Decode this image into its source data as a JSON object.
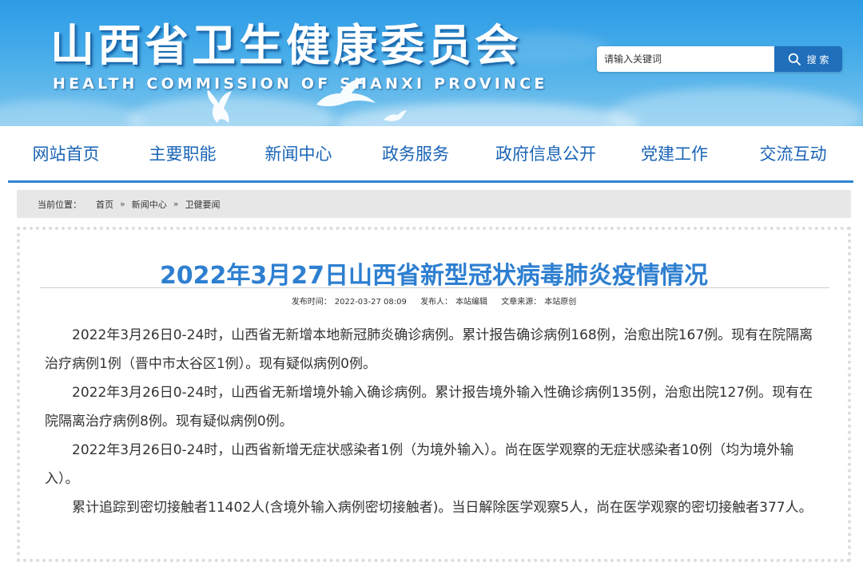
{
  "header": {
    "title": "山西省卫生健康委员会",
    "subtitle": "HEALTH COMMISSION OF SHANXI PROVINCE",
    "search": {
      "placeholder": "请输入关键词",
      "button_label": "搜 索",
      "button_icon": "search-icon"
    }
  },
  "nav": {
    "items": [
      {
        "label": "网站首页"
      },
      {
        "label": "主要职能"
      },
      {
        "label": "新闻中心"
      },
      {
        "label": "政务服务"
      },
      {
        "label": "政府信息公开"
      },
      {
        "label": "党建工作"
      },
      {
        "label": "交流互动"
      }
    ]
  },
  "breadcrumb": {
    "label": "当前位置：",
    "items": [
      "首页",
      "新闻中心",
      "卫健要闻"
    ],
    "separator": "»"
  },
  "article": {
    "title": "2022年3月27日山西省新型冠状病毒肺炎疫情情况",
    "meta": {
      "publish_time_label": "发布时间：",
      "publish_time": "2022-03-27 08:09",
      "publisher_label": "发布人：",
      "publisher": "本站编辑",
      "source_label": "文章来源：",
      "source": "本站原创"
    },
    "paragraphs": [
      "2022年3月26日0-24时，山西省无新增本地新冠肺炎确诊病例。累计报告确诊病例168例，治愈出院167例。现有在院隔离治疗病例1例（晋中市太谷区1例）。现有疑似病例0例。",
      "2022年3月26日0-24时，山西省无新增境外输入确诊病例。累计报告境外输入性确诊病例135例，治愈出院127例。现有在院隔离治疗病例8例。现有疑似病例0例。",
      "2022年3月26日0-24时，山西省新增无症状感染者1例（为境外输入）。尚在医学观察的无症状感染者10例（均为境外输入）。",
      "累计追踪到密切接触者11402人(含境外输入病例密切接触者)。当日解除医学观察5人，尚在医学观察的密切接触者377人。"
    ]
  },
  "colors": {
    "header_blue": "#2c9be6",
    "nav_text": "#1a64b6",
    "title_blue": "#2e7fd0",
    "search_button": "#1f6fbb",
    "breadcrumb_bg": "#e7e7e7"
  }
}
